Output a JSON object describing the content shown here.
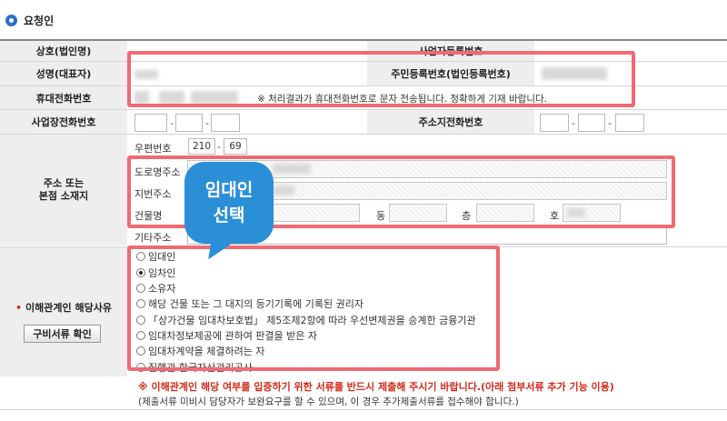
{
  "section_title": "요청인",
  "rows": {
    "company_name_label": "상호(법인명)",
    "business_no_label": "사업자등록번호",
    "name_label": "성명(대표자)",
    "resident_no_label": "주민등록번호(법인등록번호)",
    "mobile_label": "휴대전화번호",
    "mobile_note": "※ 처리결과가 휴대전화번호로 문자 전송됩니다. 정확하게 기재 바랍니다.",
    "office_phone_label": "사업장전화번호",
    "address_phone_label": "주소지전화번호",
    "phone_separator": "-",
    "address_label": "주소 또는\n본점 소재지",
    "interest_label": "이해관계인 해당사유",
    "required_mark": "•"
  },
  "address": {
    "postal_label": "우편번호",
    "postal_1": "210",
    "postal_2": "69",
    "postal_separator": "-",
    "road_label": "도로명주소",
    "lot_label": "지번주소",
    "building_label": "건물명",
    "dong_label": "동",
    "floor_label": "층",
    "unit_label": "호",
    "extra_label": "기타주소"
  },
  "callout": {
    "line1": "임대인",
    "line2": "선택"
  },
  "reasons": [
    {
      "label": "임대인",
      "checked": false
    },
    {
      "label": "임차인",
      "checked": true
    },
    {
      "label": "소유자",
      "checked": false
    },
    {
      "label": "해당 건물 또는 그 대지의 등기기록에 기록된 권리자",
      "checked": false
    },
    {
      "label": "「상가건물 임대차보호법」 제5조제2항에 따라 우선변제권을 승계한 금융기관",
      "checked": false
    },
    {
      "label": "임대차정보제공에 관하여 판결을 받은 자",
      "checked": false
    },
    {
      "label": "임대차계약을 체결하려는 자",
      "checked": false
    },
    {
      "label": "집행관 한국자산관리공사",
      "checked": false
    }
  ],
  "docs_button": "구비서류 확인",
  "notice": "※ 이해관계인 해당 여부를 입증하기 위한 서류를 반드시 제출해 주시기 바랍니다.(아래 첨부서류 추가 기능 이용)",
  "subnote": "(제출서류 미비시 담당자가 보완요구를 할 수 있으며, 이 경우 추가제출서류를 접수해야 합니다.)",
  "colors": {
    "accent": "#2d6fc9",
    "highlight": "#ef6a73",
    "callout": "#2b8fd8",
    "notice": "#d12a1a"
  }
}
